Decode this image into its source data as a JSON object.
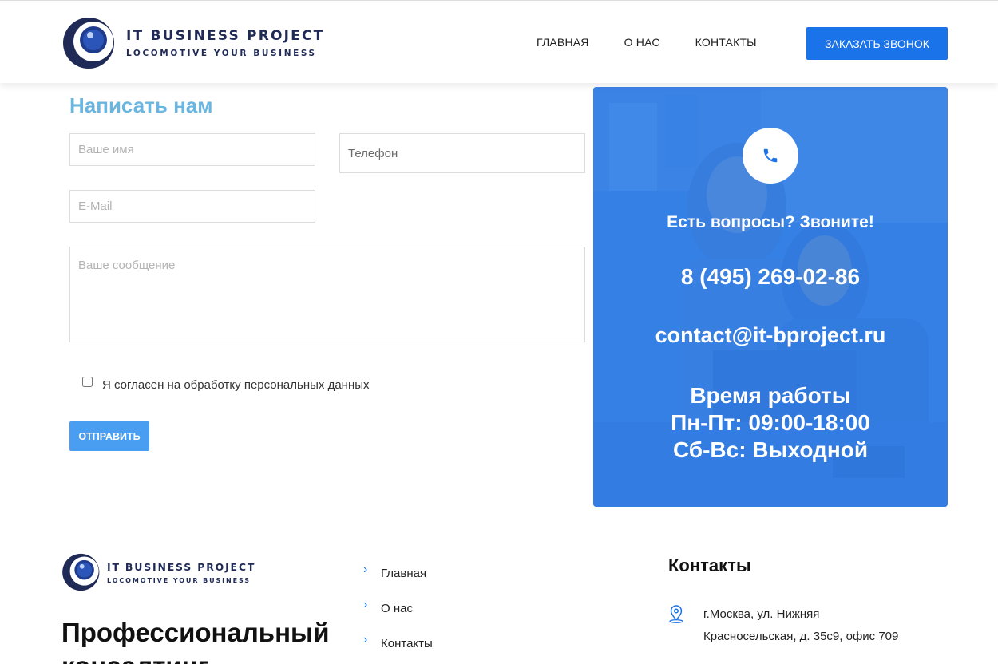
{
  "header": {
    "logo_title": "IT BUSINESS PROJECT",
    "logo_subtitle": "LOCOMOTIVE YOUR BUSINESS",
    "nav": [
      "ГЛАВНАЯ",
      "О НАС",
      "КОНТАКТЫ"
    ],
    "cta_label": "ЗАКАЗАТЬ ЗВОНОК"
  },
  "form": {
    "title": "Написать нам",
    "name_placeholder": "Ваше имя",
    "phone_placeholder": "Телефон",
    "email_placeholder": "E-Mail",
    "message_placeholder": "Ваше сообщение",
    "consent_label": "Я согласен на обработку персональных данных",
    "consent_checked": false,
    "submit_label": "ОТПРАВИТЬ"
  },
  "card": {
    "icon": "phone-icon",
    "question": "Есть вопросы? Звоните!",
    "phone": "8 (495) 269-02-86",
    "email": "contact@it-bproject.ru",
    "hours_title": "Время работы",
    "hours_weekdays": "Пн-Пт: 09:00-18:00",
    "hours_weekend": "Сб-Вс: Выходной",
    "overlay_color": "#2d7de6"
  },
  "footer": {
    "logo_title": "IT BUSINESS PROJECT",
    "logo_subtitle": "LOCOMOTIVE YOUR BUSINESS",
    "heading": "Профессиональный консалтинг",
    "links": [
      "Главная",
      "О нас",
      "Контакты"
    ],
    "contacts_title": "Контакты",
    "address": "г.Москва, ул. Нижняя Красносельская, д. 35с9, офис 709"
  },
  "colors": {
    "accent": "#1a73e8",
    "form_title": "#6ab6e0",
    "submit": "#4a9ef2",
    "logo_navy": "#1f2a56"
  }
}
